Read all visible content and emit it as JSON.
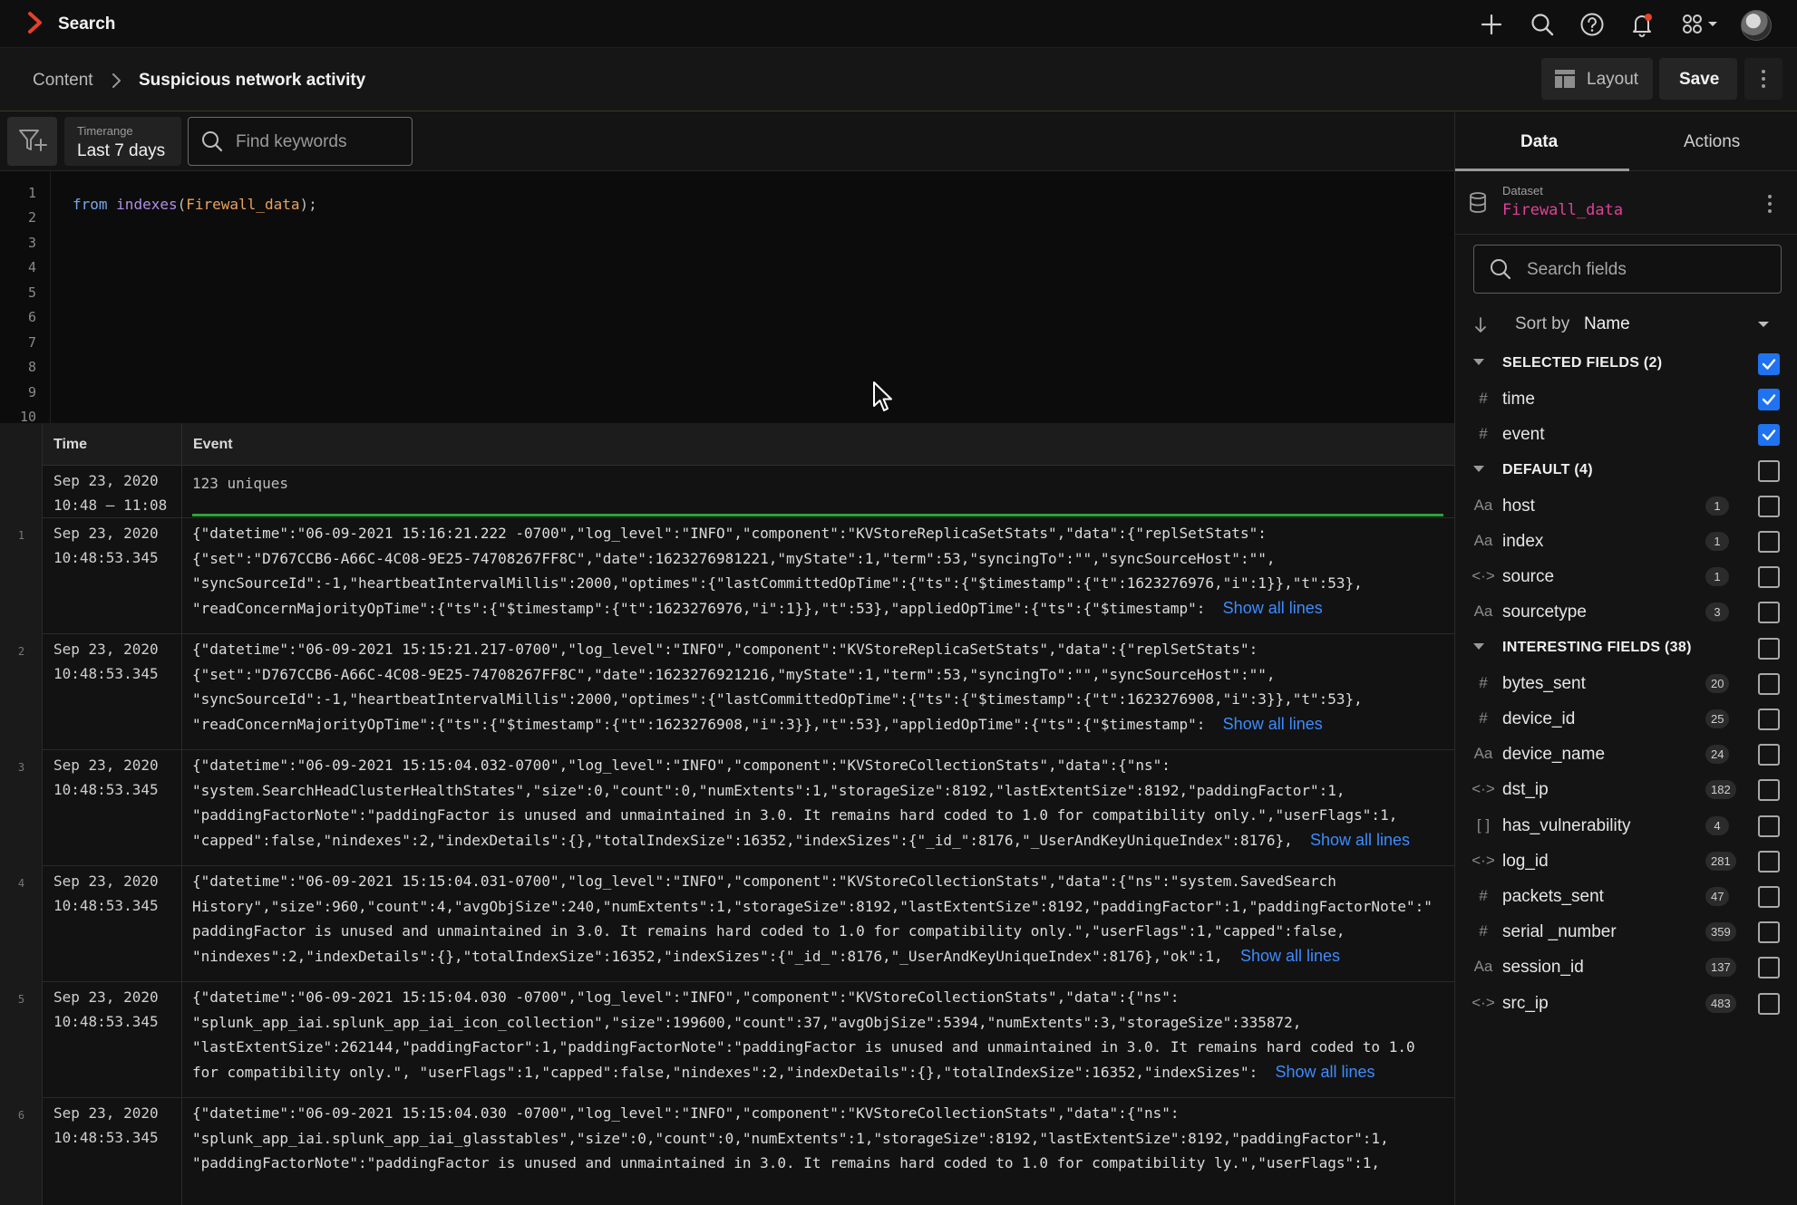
{
  "app": {
    "title": "Search"
  },
  "breadcrumb": {
    "parent": "Content",
    "current": "Suspicious network activity"
  },
  "toolbar": {
    "layout_label": "Layout",
    "save_label": "Save"
  },
  "query": {
    "timerange_caption": "Timerange",
    "timerange_value": "Last 7 days",
    "keywords_placeholder": "Find keywords",
    "code": {
      "keyword": "from",
      "function": "indexes",
      "open": "(",
      "argument": "Firewall_data",
      "close": ");"
    },
    "line_numbers": [
      "1",
      "2",
      "3",
      "4",
      "5",
      "6",
      "7",
      "8",
      "9",
      "10"
    ]
  },
  "results": {
    "columns": {
      "time": "Time",
      "event": "Event"
    },
    "summary": {
      "date": "Sep 23, 2020",
      "range": "10:48 – 11:08",
      "text": "123 uniques"
    },
    "show_all": "Show all lines",
    "rows": [
      {
        "num": "1",
        "date": "Sep 23, 2020",
        "time": "10:48:53.345",
        "lines": [
          "{\"datetime\":\"06-09-2021 15:16:21.222 -0700\",\"log_level\":\"INFO\",\"component\":\"KVStoreReplicaSetStats\",\"data\":{\"replSetStats\":",
          "{\"set\":\"D767CCB6-A66C-4C08-9E25-74708267FF8C\",\"date\":1623276981221,\"myState\":1,\"term\":53,\"syncingTo\":\"\",\"syncSourceHost\":\"\",",
          "\"syncSourceId\":-1,\"heartbeatIntervalMillis\":2000,\"optimes\":{\"lastCommittedOpTime\":{\"ts\":{\"$timestamp\":{\"t\":1623276976,\"i\":1}},\"t\":53},",
          "\"readConcernMajorityOpTime\":{\"ts\":{\"$timestamp\":{\"t\":1623276976,\"i\":1}},\"t\":53},\"appliedOpTime\":{\"ts\":{\"$timestamp\":  "
        ]
      },
      {
        "num": "2",
        "date": "Sep 23, 2020",
        "time": "10:48:53.345",
        "lines": [
          "{\"datetime\":\"06-09-2021 15:15:21.217-0700\",\"log_level\":\"INFO\",\"component\":\"KVStoreReplicaSetStats\",\"data\":{\"replSetStats\":",
          "{\"set\":\"D767CCB6-A66C-4C08-9E25-74708267FF8C\",\"date\":1623276921216,\"myState\":1,\"term\":53,\"syncingTo\":\"\",\"syncSourceHost\":\"\",",
          "\"syncSourceId\":-1,\"heartbeatIntervalMillis\":2000,\"optimes\":{\"lastCommittedOpTime\":{\"ts\":{\"$timestamp\":{\"t\":1623276908,\"i\":3}},\"t\":53},",
          "\"readConcernMajorityOpTime\":{\"ts\":{\"$timestamp\":{\"t\":1623276908,\"i\":3}},\"t\":53},\"appliedOpTime\":{\"ts\":{\"$timestamp\":  "
        ]
      },
      {
        "num": "3",
        "date": "Sep 23, 2020",
        "time": "10:48:53.345",
        "lines": [
          "{\"datetime\":\"06-09-2021 15:15:04.032-0700\",\"log_level\":\"INFO\",\"component\":\"KVStoreCollectionStats\",\"data\":{\"ns\":",
          "\"system.SearchHeadClusterHealthStates\",\"size\":0,\"count\":0,\"numExtents\":1,\"storageSize\":8192,\"lastExtentSize\":8192,\"paddingFactor\":1,",
          "\"paddingFactorNote\":\"paddingFactor is unused and unmaintained in 3.0. It remains hard coded to 1.0 for compatibility only.\",\"userFlags\":1,",
          "\"capped\":false,\"nindexes\":2,\"indexDetails\":{},\"totalIndexSize\":16352,\"indexSizes\":{\"_id_\":8176,\"_UserAndKeyUniqueIndex\":8176},  "
        ]
      },
      {
        "num": "4",
        "date": "Sep 23, 2020",
        "time": "10:48:53.345",
        "lines": [
          "{\"datetime\":\"06-09-2021 15:15:04.031-0700\",\"log_level\":\"INFO\",\"component\":\"KVStoreCollectionStats\",\"data\":{\"ns\":\"system.SavedSearch",
          "History\",\"size\":960,\"count\":4,\"avgObjSize\":240,\"numExtents\":1,\"storageSize\":8192,\"lastExtentSize\":8192,\"paddingFactor\":1,\"paddingFactorNote\":\"",
          "paddingFactor is unused and unmaintained in 3.0. It remains hard coded to 1.0 for compatibility only.\",\"userFlags\":1,\"capped\":false,",
          "\"nindexes\":2,\"indexDetails\":{},\"totalIndexSize\":16352,\"indexSizes\":{\"_id_\":8176,\"_UserAndKeyUniqueIndex\":8176},\"ok\":1,  "
        ]
      },
      {
        "num": "5",
        "date": "Sep 23, 2020",
        "time": "10:48:53.345",
        "lines": [
          "{\"datetime\":\"06-09-2021 15:15:04.030 -0700\",\"log_level\":\"INFO\",\"component\":\"KVStoreCollectionStats\",\"data\":{\"ns\":",
          "\"splunk_app_iai.splunk_app_iai_icon_collection\",\"size\":199600,\"count\":37,\"avgObjSize\":5394,\"numExtents\":3,\"storageSize\":335872,",
          "\"lastExtentSize\":262144,\"paddingFactor\":1,\"paddingFactorNote\":\"paddingFactor is unused and unmaintained in 3.0. It remains hard coded to 1.0",
          "for compatibility only.\", \"userFlags\":1,\"capped\":false,\"nindexes\":2,\"indexDetails\":{},\"totalIndexSize\":16352,\"indexSizes\":  "
        ]
      },
      {
        "num": "6",
        "date": "Sep 23, 2020",
        "time": "10:48:53.345",
        "lines": [
          "{\"datetime\":\"06-09-2021 15:15:04.030 -0700\",\"log_level\":\"INFO\",\"component\":\"KVStoreCollectionStats\",\"data\":{\"ns\":",
          "\"splunk_app_iai.splunk_app_iai_glasstables\",\"size\":0,\"count\":0,\"numExtents\":1,\"storageSize\":8192,\"lastExtentSize\":8192,\"paddingFactor\":1,",
          "\"paddingFactorNote\":\"paddingFactor is unused and unmaintained in 3.0. It remains hard coded to 1.0 for compatibility ly.\",\"userFlags\":1,",
          ""
        ]
      }
    ]
  },
  "panel": {
    "tabs": [
      "Data",
      "Actions"
    ],
    "dataset_caption": "Dataset",
    "dataset_name": "Firewall_data",
    "search_placeholder": "Search fields",
    "sort_label": "Sort by",
    "sort_value": "Name",
    "sections": [
      {
        "title": "SELECTED FIELDS (2)",
        "checked": true,
        "fields": [
          {
            "type": "#",
            "name": "time",
            "count": "",
            "checked": true
          },
          {
            "type": "#",
            "name": "event",
            "count": "",
            "checked": true
          }
        ]
      },
      {
        "title": "DEFAULT (4)",
        "checked": false,
        "fields": [
          {
            "type": "Aa",
            "name": "host",
            "count": "1",
            "checked": false
          },
          {
            "type": "Aa",
            "name": "index",
            "count": "1",
            "checked": false
          },
          {
            "type": "<·>",
            "name": "source",
            "count": "1",
            "checked": false
          },
          {
            "type": "Aa",
            "name": "sourcetype",
            "count": "3",
            "checked": false
          }
        ]
      },
      {
        "title": "INTERESTING FIELDS  (38)",
        "checked": false,
        "fields": [
          {
            "type": "#",
            "name": "bytes_sent",
            "count": "20",
            "checked": false
          },
          {
            "type": "#",
            "name": "device_id",
            "count": "25",
            "checked": false
          },
          {
            "type": "Aa",
            "name": "device_name",
            "count": "24",
            "checked": false
          },
          {
            "type": "<·>",
            "name": "dst_ip",
            "count": "182",
            "checked": false
          },
          {
            "type": "[ ]",
            "name": "has_vulnerability",
            "count": "4",
            "checked": false
          },
          {
            "type": "<·>",
            "name": "log_id",
            "count": "281",
            "checked": false
          },
          {
            "type": "#",
            "name": "packets_sent",
            "count": "47",
            "checked": false
          },
          {
            "type": "#",
            "name": "serial _number",
            "count": "359",
            "checked": false
          },
          {
            "type": "Aa",
            "name": "session_id",
            "count": "137",
            "checked": false
          },
          {
            "type": "<·>",
            "name": "src_ip",
            "count": "483",
            "checked": false
          }
        ]
      }
    ]
  },
  "colors": {
    "accent": "#1f73f0",
    "link": "#3d8cff",
    "dataset": "#e0409a",
    "brand": "#e8402a",
    "bar": "#2aa33a"
  }
}
